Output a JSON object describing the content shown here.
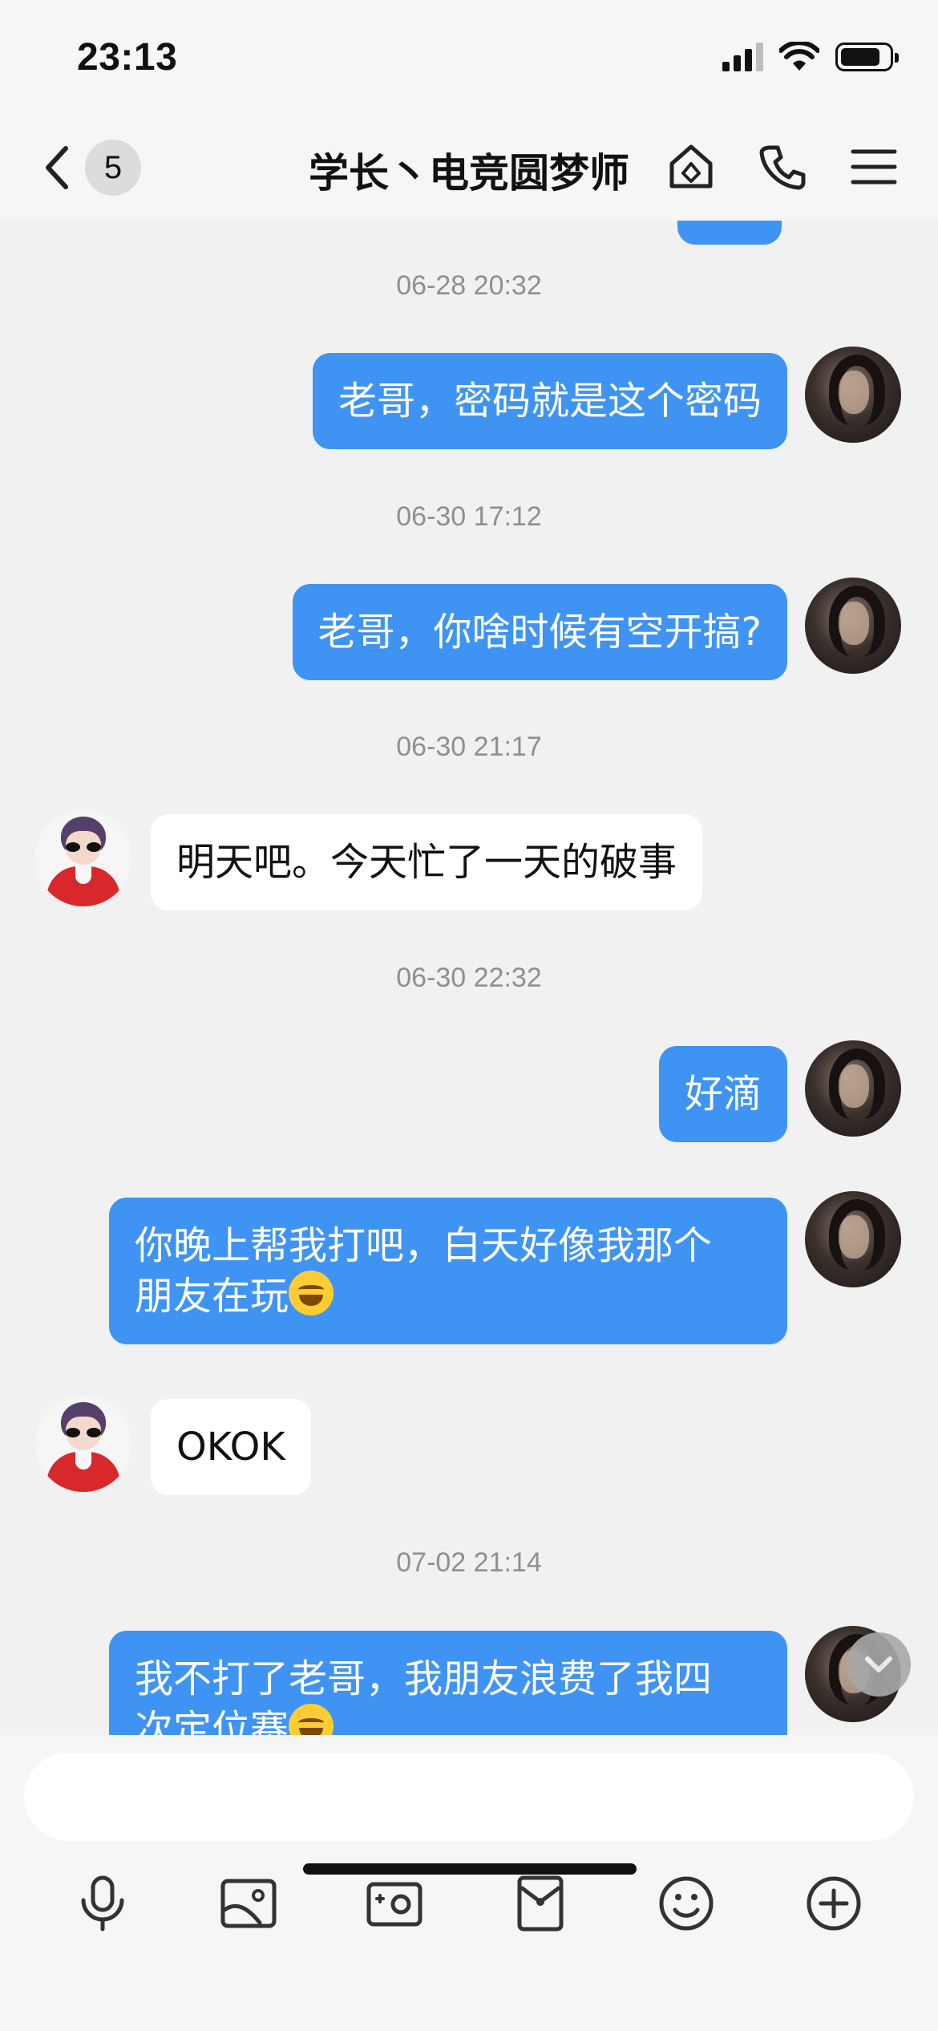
{
  "status_bar": {
    "time": "23:13"
  },
  "nav": {
    "back_badge": "5",
    "title": "学长丶电竞圆梦师",
    "icons": [
      "home-shield-icon",
      "phone-icon",
      "menu-icon"
    ]
  },
  "messages": {
    "stamp1": "06-28 20:32",
    "msg1": "老哥，密码就是这个密码",
    "stamp2": "06-30 17:12",
    "msg2": "老哥，你啥时候有空开搞?",
    "stamp3": "06-30 21:17",
    "msg3": "明天吧。今天忙了一天的破事",
    "stamp4": "06-30 22:32",
    "msg4": "好滴",
    "msg5_line1": "你晚上帮我打吧，白天好像我那个",
    "msg5_line2": "朋友在玩",
    "msg6": "OKOK",
    "stamp5": "07-02 21:14",
    "msg7_line1": "我不打了老哥，我朋友浪费了我四",
    "msg7_line2": "次定位赛"
  },
  "composer": {
    "input_value": "",
    "tools": [
      "microphone-icon",
      "image-icon",
      "camera-icon",
      "red-packet-icon",
      "emoji-icon",
      "plus-icon"
    ]
  },
  "colors": {
    "outgoing_bubble": "#3f94f3",
    "incoming_bubble": "#ffffff",
    "background": "#f1f1f1"
  }
}
